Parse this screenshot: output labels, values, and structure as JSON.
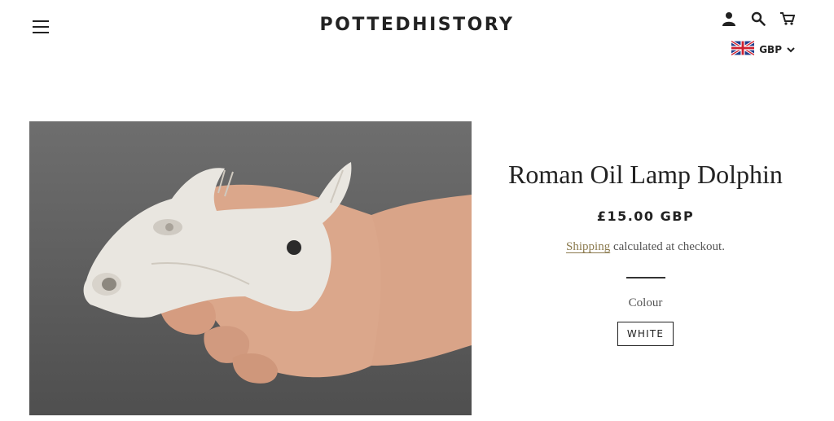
{
  "header": {
    "logo": "POTTEDHISTORY",
    "menu_icon": "hamburger-menu-icon",
    "account_icon": "user-icon",
    "search_icon": "search-icon",
    "cart_icon": "cart-icon",
    "currency": {
      "flag_icon": "uk-flag-icon",
      "label": "GBP"
    }
  },
  "product": {
    "image_alt": "Roman oil lamp shaped like a dolphin held in a hand",
    "title": "Roman Oil Lamp Dolphin",
    "price": "£15.00 GBP",
    "shipping_link": "Shipping",
    "shipping_text": " calculated at checkout.",
    "colour_label": "Colour",
    "colour_option": "WHITE"
  },
  "colors": {
    "text": "#222222",
    "link": "#8b7a4e",
    "muted": "#555555"
  }
}
